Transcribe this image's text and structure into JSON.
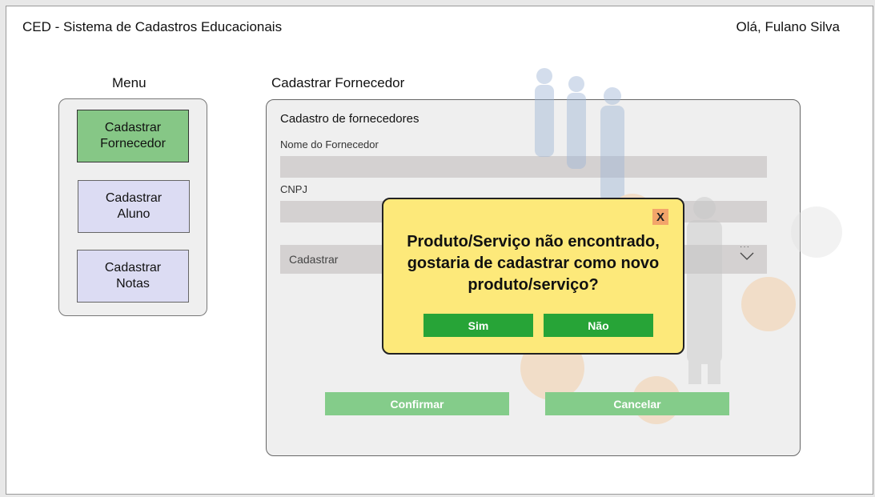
{
  "header": {
    "app_title": "CED - Sistema de Cadastros Educacionais",
    "greeting": "Olá, Fulano Silva"
  },
  "menu": {
    "title": "Menu",
    "items": [
      {
        "line1": "Cadastrar",
        "line2": "Fornecedor",
        "active": true
      },
      {
        "line1": "Cadastrar",
        "line2": "Aluno",
        "active": false
      },
      {
        "line1": "Cadastrar",
        "line2": "Notas",
        "active": false
      }
    ]
  },
  "main": {
    "page_title": "Cadastrar Fornecedor",
    "panel_heading": "Cadastro de fornecedores",
    "fields": {
      "name_label": "Nome do Fornecedor",
      "name_value": "",
      "cnpj_label": "CNPJ",
      "cnpj_value": ""
    },
    "select": {
      "selected": "Cadastrar",
      "icon": "chevron-down-icon"
    },
    "confirm_label": "Confirmar",
    "cancel_label": "Cancelar"
  },
  "dialog": {
    "close_label": "X",
    "message_lines": [
      "Produto/Serviço não encontrado,",
      "gostaria de cadastrar como novo",
      "produto/serviço?"
    ],
    "yes_label": "Sim",
    "no_label": "Não"
  },
  "colors": {
    "active_menu": "#86c786",
    "inactive_menu": "#dcdcf3",
    "dialog_bg": "#fde97a",
    "dialog_button": "#27a437",
    "action_button": "#84cc8a",
    "close_button": "#f3a56a"
  }
}
